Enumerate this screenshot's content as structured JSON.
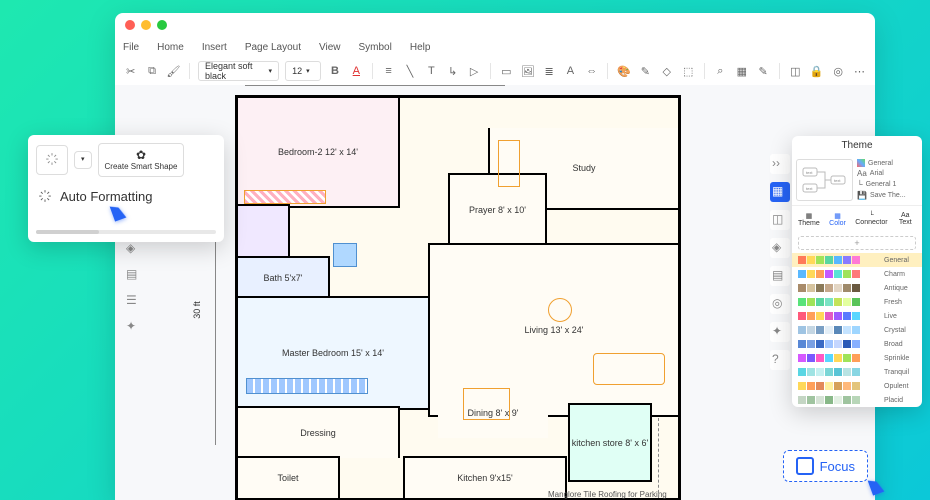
{
  "menu": {
    "file": "File",
    "home": "Home",
    "insert": "Insert",
    "page_layout": "Page Layout",
    "view": "View",
    "symbol": "Symbol",
    "help": "Help"
  },
  "toolbar": {
    "font": "Elegant soft black",
    "size": "12"
  },
  "ruler": {
    "vertical": "30 ft"
  },
  "rooms": {
    "bedroom2": "Bedroom-2 12' x 14'",
    "study": "Study",
    "prayer": "Prayer 8' x 10'",
    "bath": "Bath 5'x7'",
    "master": "Master Bedroom 15' x 14'",
    "living": "Living 13' x 24'",
    "dining": "Dining 8' x 9'",
    "kitchen_store": "kitchen store 8' x 6'",
    "dressing": "Dressing",
    "toilet": "Toilet",
    "kitchen": "Kitchen 9'x15'",
    "parking_note": "Manglore Tile Roofing for Parking"
  },
  "autofmt": {
    "create_smart": "Create Smart Shape",
    "title": "Auto Formatting"
  },
  "theme": {
    "title": "Theme",
    "list": {
      "general": "General",
      "arial": "Arial",
      "general1": "General 1",
      "save": "Save The..."
    },
    "tabs": {
      "theme": "Theme",
      "color": "Color",
      "connector": "Connector",
      "text": "Text"
    },
    "swatches": [
      "General",
      "Charm",
      "Antique",
      "Fresh",
      "Live",
      "Crystal",
      "Broad",
      "Sprinkle",
      "Tranquil",
      "Opulent",
      "Placid"
    ]
  },
  "focus": {
    "label": "Focus"
  },
  "colors": {
    "traffic": {
      "red": "#ff5f56",
      "yellow": "#ffbd2e",
      "green": "#27c93f"
    },
    "accent": "#2563f5",
    "swatch_rows": [
      [
        "#ff7a59",
        "#ffd859",
        "#9fe359",
        "#59d6a0",
        "#59b8ff",
        "#8a7aff",
        "#ff7ad6"
      ],
      [
        "#59b8ff",
        "#ffd859",
        "#ff9f59",
        "#c559ff",
        "#59e3d6",
        "#9fe359",
        "#ff7a7a"
      ],
      [
        "#a88b6a",
        "#d6c49f",
        "#8a7a59",
        "#c4a88b",
        "#e3d6c4",
        "#9f8a6a",
        "#6a5940"
      ],
      [
        "#59e37a",
        "#9fe359",
        "#59d6a0",
        "#7ae3c4",
        "#c4e359",
        "#e3ff9f",
        "#59c459"
      ],
      [
        "#ff597a",
        "#ff9f59",
        "#ffd859",
        "#e359c4",
        "#a059ff",
        "#597aff",
        "#59d6ff"
      ],
      [
        "#9fc4e3",
        "#c4d6e3",
        "#7a9fc4",
        "#e3eef7",
        "#5988b8",
        "#c4e3ff",
        "#9fd6ff"
      ],
      [
        "#5988d6",
        "#7aa0e3",
        "#3a6ac4",
        "#9fc4ff",
        "#c4d6ff",
        "#2a5ab8",
        "#88b0ff"
      ],
      [
        "#d659ff",
        "#7a59ff",
        "#ff59c4",
        "#59d6ff",
        "#ffd859",
        "#9fe359",
        "#ff9f59"
      ],
      [
        "#59d6e3",
        "#9fe3e3",
        "#c4f0f0",
        "#7ad6d6",
        "#59c4d6",
        "#b8e3e3",
        "#88d6e3"
      ],
      [
        "#ffd859",
        "#ff9f59",
        "#e38a59",
        "#fff09f",
        "#d6a059",
        "#ffb87a",
        "#e3c47a"
      ],
      [
        "#c4d6c4",
        "#a0c4a0",
        "#d6e3d6",
        "#88b888",
        "#e3f0e3",
        "#9fc49f",
        "#b8d6b8"
      ]
    ]
  }
}
